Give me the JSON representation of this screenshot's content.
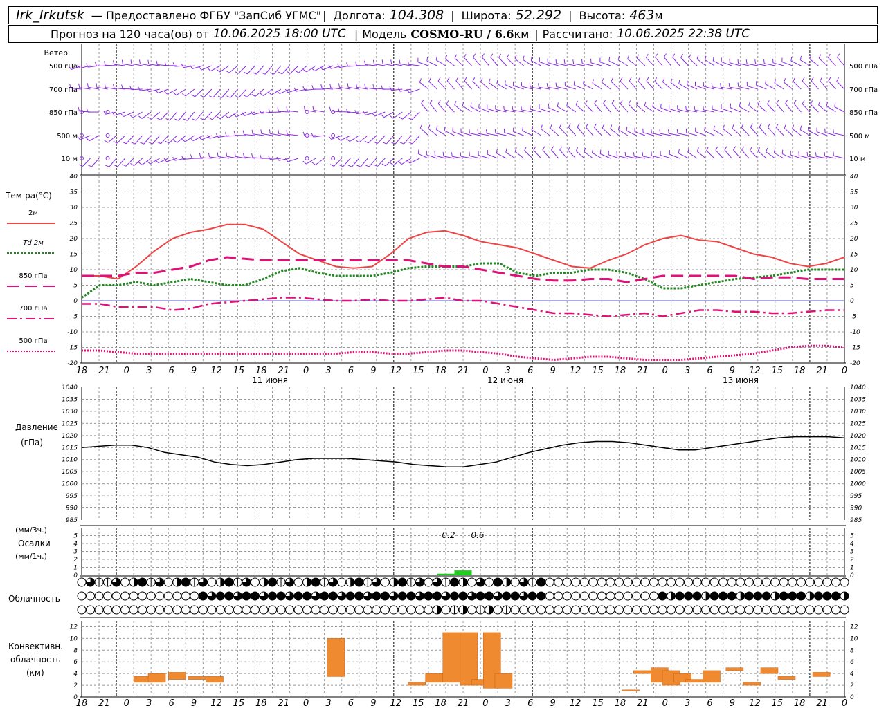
{
  "header": {
    "station": "Irk_Irkutsk",
    "provided_by": "— Предоставлено ФГБУ \"ЗапСиб УГМС\"",
    "lon_label": "Долгота:",
    "lon_value": "104.308",
    "lat_label": "Широта:",
    "lat_value": "52.292",
    "alt_label": "Высота:",
    "alt_value": "463",
    "alt_unit": "м",
    "forecast_label": "Прогноз на 120 часа(ов) от",
    "forecast_time": "10.06.2025 18:00 UTC",
    "model_label": "Модель",
    "model_name": "COSMO-RU / 6.6",
    "model_unit": "км",
    "calc_label": "Рассчитано:",
    "calc_time": "10.06.2025 22:38 UTC"
  },
  "colors": {
    "wind": "#8a2be2",
    "t2m": "#ee4444",
    "td2m": "#228822",
    "t850": "#dd1177",
    "t700": "#dd1177",
    "t500": "#dd1177",
    "pressure": "#000000",
    "precip": "#22cc22",
    "conv": "#f08a30",
    "grid": "#999999",
    "zero_line": "#5555cc"
  },
  "axes": {
    "hour_ticks": [
      "18",
      "21",
      "0",
      "3",
      "6",
      "9",
      "12",
      "15",
      "18",
      "21",
      "0",
      "3",
      "6",
      "9",
      "12",
      "15",
      "18",
      "21",
      "0",
      "3",
      "6",
      "9",
      "12",
      "15",
      "18",
      "21",
      "0",
      "3",
      "6",
      "9",
      "12",
      "15",
      "18",
      "21",
      "0"
    ],
    "date_labels": [
      "11 июня",
      "12 июня",
      "13 июня"
    ]
  },
  "wind_panel": {
    "title": "Ветер",
    "levels": [
      "500 гПа",
      "700 гПа",
      "850 гПа",
      "500 м",
      "10 м"
    ]
  },
  "temp_panel": {
    "title": "Тем-ра(°С)",
    "legend": [
      {
        "label": "2м",
        "key": "t2m"
      },
      {
        "label": "Td  2м",
        "key": "td2m"
      },
      {
        "label": "850 гПа",
        "key": "t850"
      },
      {
        "label": "700 гПа",
        "key": "t700"
      },
      {
        "label": "500 гПа",
        "key": "t500"
      }
    ]
  },
  "pressure_panel": {
    "title": "Давление",
    "unit": "(гПа)"
  },
  "precip_panel": {
    "unit3": "(мм/3ч.)",
    "title": "Осадки",
    "unit1": "(мм/1ч.)",
    "labels": [
      "0.2",
      "0.6"
    ]
  },
  "cloud_panel": {
    "title": "Облачность"
  },
  "conv_panel": {
    "title": "Конвективн.",
    "title2": "облачность",
    "unit": "(км)"
  },
  "chart_data": [
    {
      "type": "line",
      "title": "Тем-ра(°С)",
      "x_hours": [
        0,
        3,
        6,
        9,
        12,
        15,
        18,
        21,
        24,
        27,
        30,
        33,
        36,
        39,
        42,
        45,
        48,
        51,
        54,
        57,
        60,
        63,
        66,
        69,
        72,
        75,
        78,
        81,
        84,
        87,
        90,
        93,
        96,
        99,
        102
      ],
      "ylim": [
        -20,
        40
      ],
      "series": [
        {
          "name": "2м",
          "values": [
            8,
            8,
            7,
            11,
            16,
            20,
            22,
            23,
            24.5,
            24.5,
            23,
            19,
            15,
            13,
            11,
            10.5,
            11,
            15,
            20,
            22,
            22.5,
            21,
            19,
            18,
            17,
            15,
            13,
            11,
            10.5,
            13,
            15,
            18,
            20,
            21,
            19.5,
            19,
            17,
            15,
            14,
            12,
            11,
            12,
            14
          ]
        },
        {
          "name": "Td 2м",
          "values": [
            1,
            5,
            5,
            6,
            5,
            6,
            7,
            6,
            5,
            5,
            7,
            9.5,
            10.5,
            9,
            8,
            8,
            8,
            9,
            10.5,
            11,
            11,
            11,
            12,
            12,
            9,
            8,
            9,
            9,
            10,
            10,
            9,
            7,
            4,
            4,
            5,
            6,
            7,
            7.5,
            8,
            9,
            10,
            10,
            10
          ]
        },
        {
          "name": "850 гПа",
          "values": [
            8,
            8,
            8,
            9,
            9,
            10,
            11,
            13,
            14,
            13.5,
            13,
            13,
            13,
            13,
            13,
            13,
            13,
            13,
            13,
            12,
            11,
            11,
            10,
            9,
            8,
            7,
            6.5,
            6.5,
            7,
            7,
            6,
            7,
            8,
            8,
            8,
            8,
            8,
            7,
            7.5,
            7.5,
            7,
            7,
            7
          ]
        },
        {
          "name": "700 гПа",
          "values": [
            -1,
            -1,
            -2,
            -2,
            -2,
            -3,
            -2.5,
            -1,
            -0.5,
            0,
            0.5,
            1,
            1,
            0.5,
            0,
            0,
            0.5,
            0,
            0,
            0.5,
            1,
            0,
            0,
            -1,
            -2,
            -3,
            -4,
            -4,
            -4.5,
            -5,
            -4.5,
            -4,
            -5,
            -4,
            -3,
            -3,
            -3.5,
            -3.5,
            -4,
            -4,
            -3.5,
            -3,
            -3
          ]
        },
        {
          "name": "500 гПа",
          "values": [
            -16,
            -16,
            -16.5,
            -17,
            -17,
            -17,
            -17,
            -17,
            -17,
            -17,
            -17,
            -17,
            -17,
            -17,
            -17,
            -16.5,
            -16.5,
            -17,
            -17,
            -16.5,
            -16,
            -16,
            -16.5,
            -17,
            -18,
            -18.5,
            -19,
            -18.5,
            -18,
            -18,
            -18.5,
            -19,
            -19,
            -19,
            -18.5,
            -18,
            -17.5,
            -17,
            -16,
            -15,
            -14.5,
            -14.5,
            -15
          ]
        }
      ]
    },
    {
      "type": "line",
      "title": "Давление",
      "ylim": [
        985,
        1040
      ],
      "series": [
        {
          "name": "Давление",
          "values": [
            1015,
            1015.5,
            1016,
            1016,
            1015,
            1013,
            1012,
            1011,
            1009,
            1008,
            1007.5,
            1008,
            1009,
            1010,
            1010.5,
            1010.5,
            1010.5,
            1010,
            1009.5,
            1009,
            1008,
            1007.5,
            1007,
            1007,
            1008,
            1009,
            1011,
            1013,
            1014.5,
            1016,
            1017,
            1017.5,
            1017.5,
            1017,
            1016,
            1015,
            1014,
            1014,
            1015,
            1016,
            1017,
            1018,
            1019,
            1019.5,
            1019.5,
            1019.5,
            1019
          ]
        }
      ]
    },
    {
      "type": "bar",
      "title": "Осадки",
      "ylim": [
        0,
        6
      ],
      "bars": [
        {
          "x_hour": 63,
          "value": 0.2
        },
        {
          "x_hour": 66,
          "value": 0.6
        }
      ]
    },
    {
      "type": "bar",
      "title": "Конвективн. облачность",
      "ylim": [
        0,
        13
      ],
      "bars": [
        {
          "x_hour": 10.5,
          "base": 2.5,
          "top": 3.5
        },
        {
          "x_hour": 13,
          "base": 2.5,
          "top": 4
        },
        {
          "x_hour": 16.5,
          "base": 3,
          "top": 4.2
        },
        {
          "x_hour": 20,
          "base": 3,
          "top": 3.5
        },
        {
          "x_hour": 23,
          "base": 2.5,
          "top": 3.5
        },
        {
          "x_hour": 44,
          "base": 3.5,
          "top": 10
        },
        {
          "x_hour": 58,
          "base": 2,
          "top": 2.5
        },
        {
          "x_hour": 61,
          "base": 2.5,
          "top": 4
        },
        {
          "x_hour": 64,
          "base": 2.5,
          "top": 11
        },
        {
          "x_hour": 67,
          "base": 2,
          "top": 11
        },
        {
          "x_hour": 69,
          "base": 2,
          "top": 3
        },
        {
          "x_hour": 71,
          "base": 1.5,
          "top": 11
        },
        {
          "x_hour": 73,
          "base": 1.5,
          "top": 4
        },
        {
          "x_hour": 95,
          "base": 1,
          "top": 1.2
        },
        {
          "x_hour": 97,
          "base": 4,
          "top": 4.5
        },
        {
          "x_hour": 100,
          "base": 2.5,
          "top": 5
        },
        {
          "x_hour": 102,
          "base": 2,
          "top": 4.5
        },
        {
          "x_hour": 104,
          "base": 2.5,
          "top": 4
        },
        {
          "x_hour": 106,
          "base": 2.5,
          "top": 3
        },
        {
          "x_hour": 109,
          "base": 2.5,
          "top": 4.5
        },
        {
          "x_hour": 113,
          "base": 4.5,
          "top": 5
        },
        {
          "x_hour": 116,
          "base": 2,
          "top": 2.5
        },
        {
          "x_hour": 119,
          "base": 4,
          "top": 5
        },
        {
          "x_hour": 122,
          "base": 3,
          "top": 3.5
        },
        {
          "x_hour": 128,
          "base": 3.5,
          "top": 4.2
        }
      ]
    }
  ]
}
